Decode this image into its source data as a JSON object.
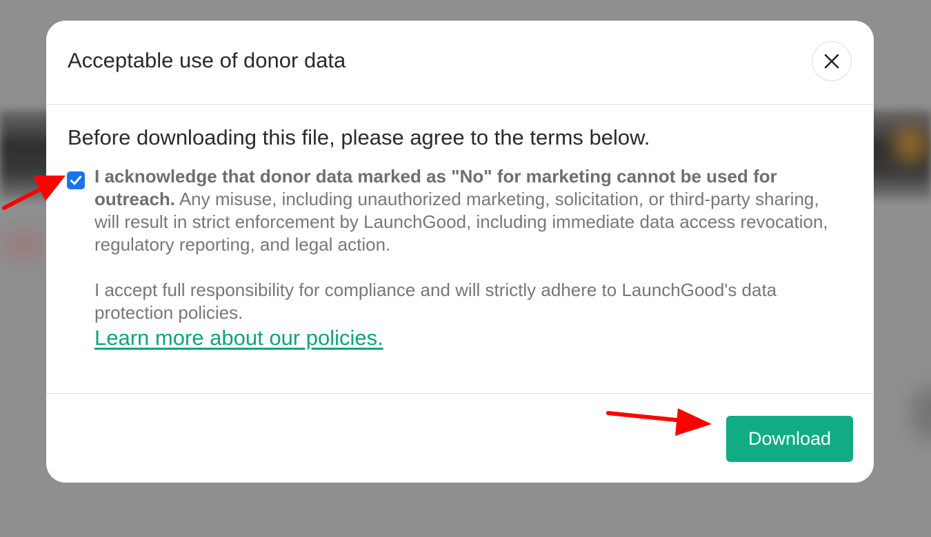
{
  "dialog": {
    "title": "Acceptable use of donor data",
    "close_icon": "close-icon"
  },
  "body": {
    "intro": "Before downloading this file, please agree to the terms below.",
    "checkbox_checked": true,
    "terms_bold": "I acknowledge that donor data marked as \"No\" for marketing cannot be used for outreach.",
    "terms_rest": " Any misuse, including unauthorized marketing, solicitation, or third-party sharing, will result in strict enforcement by LaunchGood, including immediate data access revocation, regulatory reporting, and legal action.",
    "responsibility": "I accept full responsibility for compliance and will strictly adhere to LaunchGood's data protection policies.",
    "learn_more_link": "Learn more about our policies."
  },
  "footer": {
    "download_label": "Download"
  },
  "colors": {
    "accent": "#10ac84",
    "checkbox": "#1a73e8",
    "annotation_arrow": "#ff0000"
  }
}
